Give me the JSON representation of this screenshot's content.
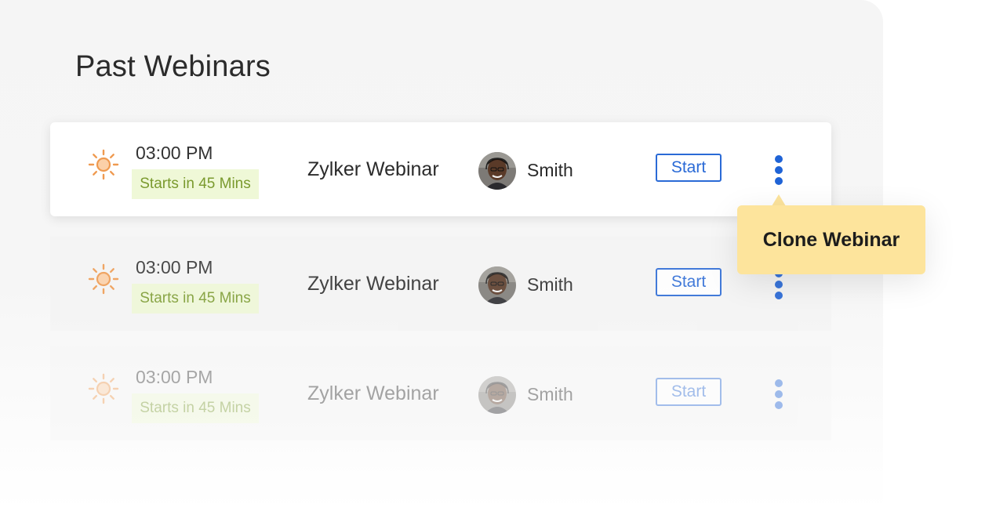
{
  "page": {
    "title": "Past Webinars"
  },
  "webinars": [
    {
      "time": "03:00 PM",
      "status": "Starts in 45 Mins",
      "name": "Zylker Webinar",
      "host": "Smith",
      "start_label": "Start",
      "icon": "sun-icon",
      "menu_icon": "vertical-ellipsis-icon"
    },
    {
      "time": "03:00 PM",
      "status": "Starts in 45 Mins",
      "name": "Zylker Webinar",
      "host": "Smith",
      "start_label": "Start",
      "icon": "sun-icon",
      "menu_icon": "vertical-ellipsis-icon"
    },
    {
      "time": "03:00 PM",
      "status": "Starts in 45 Mins",
      "name": "Zylker Webinar",
      "host": "Smith",
      "start_label": "Start",
      "icon": "sun-icon",
      "menu_icon": "vertical-ellipsis-icon"
    }
  ],
  "tooltip": {
    "label": "Clone Webinar"
  },
  "colors": {
    "accent": "#2a6ad6",
    "status_bg": "#eff8d7",
    "status_text": "#7a9a2e",
    "tooltip_bg": "#fde49c",
    "sun": "#f0a05a"
  }
}
